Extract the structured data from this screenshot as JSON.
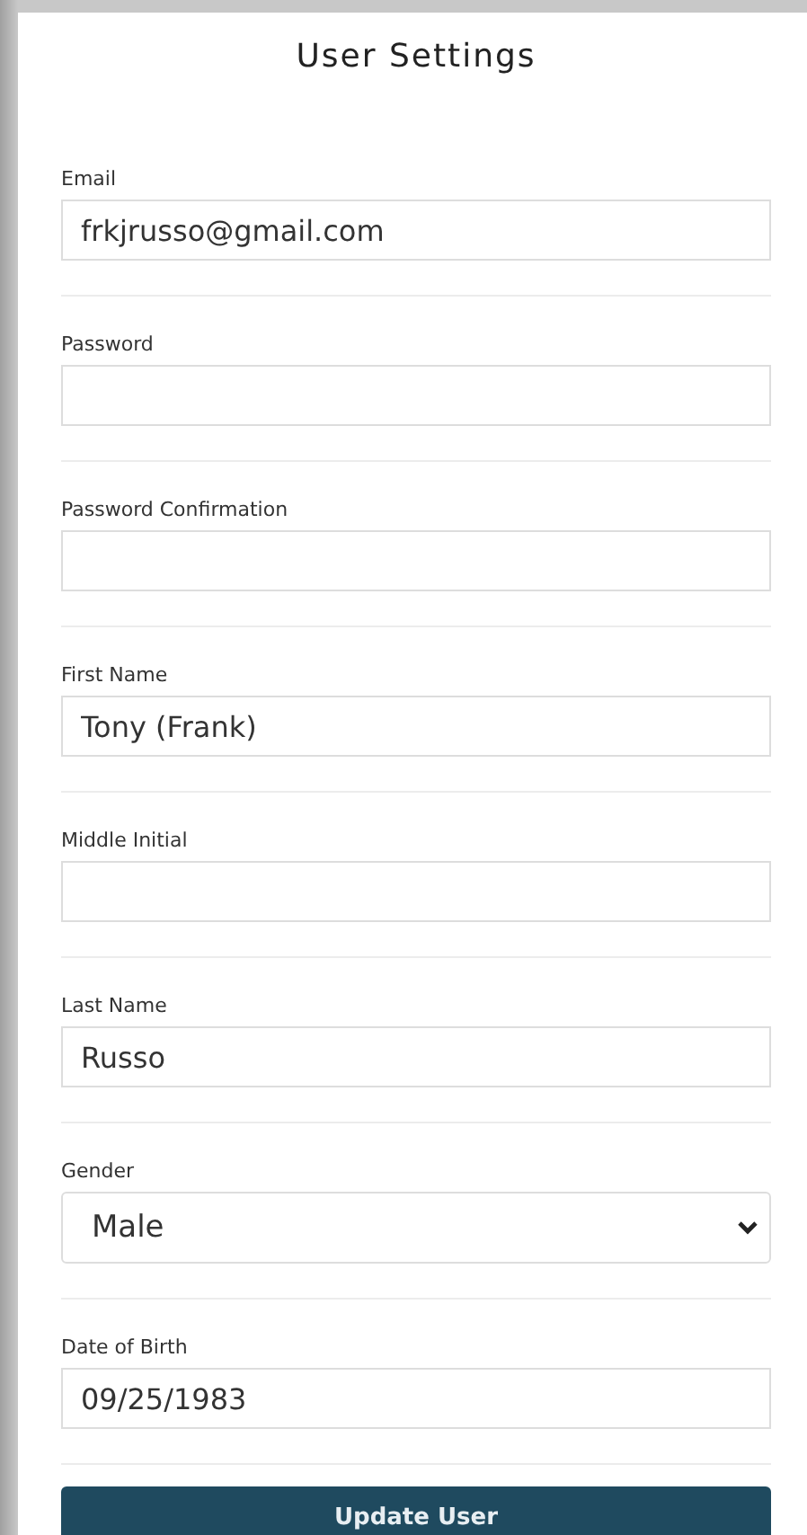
{
  "title": "User Settings",
  "fields": [
    {
      "kind": "text",
      "label": "Email",
      "value": "frkjrusso@gmail.com"
    },
    {
      "kind": "text",
      "label": "Password"
    },
    {
      "kind": "text",
      "label": "Password Confirmation"
    },
    {
      "kind": "text",
      "label": "First Name",
      "value": "Tony (Frank)"
    },
    {
      "kind": "text",
      "label": "Middle Initial"
    },
    {
      "kind": "text",
      "label": "Last Name",
      "value": "Russo"
    },
    {
      "kind": "select",
      "label": "Gender",
      "value": "Male"
    },
    {
      "kind": "text",
      "label": "Date of Birth",
      "value": "09/25/1983"
    }
  ],
  "button": "Update User"
}
